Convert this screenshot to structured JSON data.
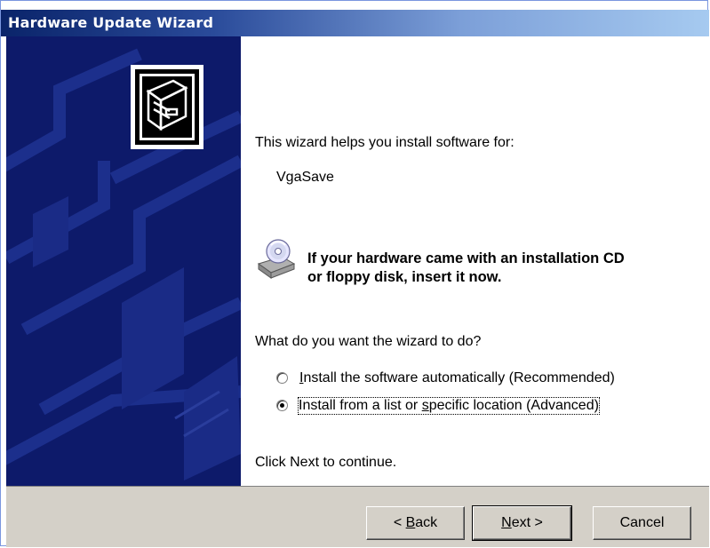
{
  "window": {
    "title": "Hardware Update Wizard"
  },
  "content": {
    "intro": "This wizard helps you install software for:",
    "device_name": "VgaSave",
    "cd_notice_line1": "If your hardware came with an installation CD",
    "cd_notice_line2": "or floppy disk, insert it now.",
    "question": "What do you want the wizard to do?",
    "options": [
      {
        "label_pre": "",
        "label_ul": "I",
        "label_post": "nstall the software automatically (Recommended)",
        "selected": false
      },
      {
        "label_pre": "Install from a list or ",
        "label_ul": "s",
        "label_post": "pecific location (Advanced)",
        "selected": true
      }
    ],
    "footer_hint": "Click Next to continue."
  },
  "buttons": {
    "back": {
      "pre": "< ",
      "ul": "B",
      "post": "ack"
    },
    "next": {
      "pre": "",
      "ul": "N",
      "post": "ext >"
    },
    "cancel": "Cancel"
  },
  "colors": {
    "title_bar_start": "#0a246a",
    "side_panel": "#0d1a6a",
    "button_face": "#d4d0c8"
  },
  "icons": [
    "hardware-box-icon",
    "cd-drive-icon"
  ]
}
